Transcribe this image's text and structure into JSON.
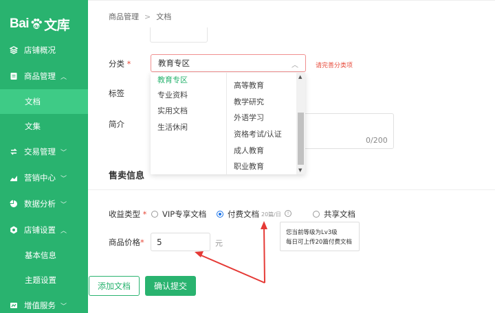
{
  "logo": {
    "text": "Bai",
    "badge": "du",
    "suffix": "文库"
  },
  "sidebar": {
    "items": [
      {
        "label": "店铺概况",
        "icon": "layers-icon"
      },
      {
        "label": "商品管理",
        "icon": "document-icon",
        "chevron": "^"
      },
      {
        "label": "交易管理",
        "icon": "exchange-icon",
        "chevron": "v"
      },
      {
        "label": "营销中心",
        "icon": "trend-icon",
        "chevron": "v"
      },
      {
        "label": "数据分析",
        "icon": "pie-chart-icon",
        "chevron": "v"
      },
      {
        "label": "店铺设置",
        "icon": "gear-icon",
        "chevron": "^"
      },
      {
        "label": "增值服务",
        "icon": "chart-icon",
        "chevron": "v"
      }
    ],
    "sub_goods": [
      "文档",
      "文集"
    ],
    "sub_shop": [
      "基本信息",
      "主题设置"
    ]
  },
  "breadcrumb": {
    "root": "商品管理",
    "current": "文档"
  },
  "form": {
    "category_label": "分类",
    "required_mark": "*",
    "category_value": "教育专区",
    "category_error": "请完善分类项",
    "tags_label": "标签",
    "intro_label": "简介",
    "intro_counter": "0/200",
    "dropdown_col1": [
      "教育专区",
      "专业资料",
      "实用文档",
      "生活休闲"
    ],
    "dropdown_col2": [
      "高等教育",
      "教学研究",
      "外语学习",
      "资格考试/认证",
      "成人教育",
      "职业教育"
    ]
  },
  "sale": {
    "section_title": "售卖信息",
    "type_label": "收益类型",
    "options": [
      "VIP专享文档",
      "付费文档",
      "共享文档"
    ],
    "selected": 1,
    "paid_note": "20篇/日",
    "tooltip_line1": "您当前等级为Lv3级",
    "tooltip_line2": "每日可上传20篇付费文档",
    "price_label": "商品价格",
    "price_value": "5",
    "price_unit": "元"
  },
  "buttons": {
    "add": "添加文档",
    "submit": "确认提交"
  },
  "colors": {
    "brand": "#29b36f",
    "error": "#e74c3c",
    "arrow": "#e53935"
  }
}
